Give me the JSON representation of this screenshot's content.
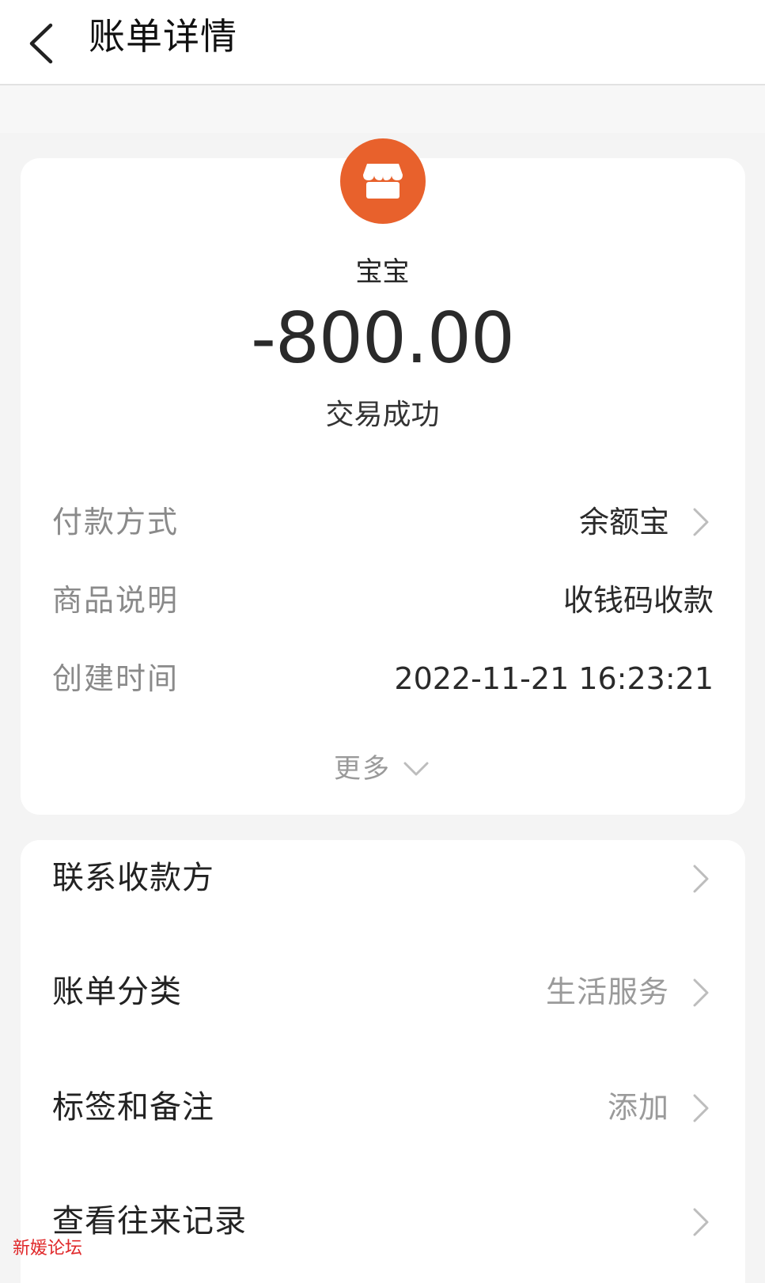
{
  "header": {
    "title": "账单详情",
    "back_icon": "chevron-left-icon"
  },
  "summary": {
    "merchant_icon": "store-icon",
    "merchant_icon_color": "#e8612c",
    "merchant_name": "宝宝",
    "amount": "-800.00",
    "status": "交易成功"
  },
  "details": [
    {
      "label": "付款方式",
      "value": "余额宝"
    },
    {
      "label": "商品说明",
      "value": "收钱码收款"
    },
    {
      "label": "创建时间",
      "value": "2022-11-21 16:23:21"
    }
  ],
  "more": {
    "label": "更多",
    "icon": "chevron-down-icon"
  },
  "menu": [
    {
      "label": "联系收款方",
      "value": ""
    },
    {
      "label": "账单分类",
      "value": "生活服务"
    },
    {
      "label": "标签和备注",
      "value": "添加"
    },
    {
      "label": "查看往来记录",
      "value": ""
    }
  ],
  "watermark": "新媛论坛"
}
